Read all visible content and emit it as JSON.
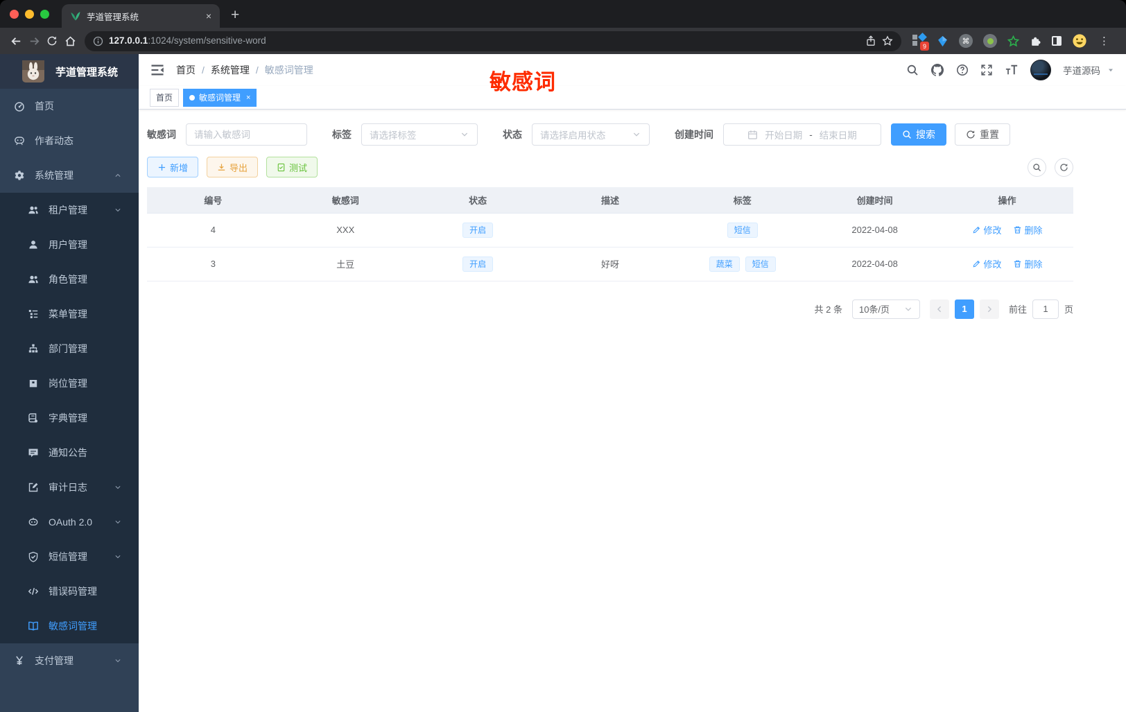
{
  "browser": {
    "tab_title": "芋道管理系统",
    "new_tab": "+",
    "close_tab": "×",
    "url_host": "127.0.0.1",
    "url_path": ":1024/system/sensitive-word",
    "extension_badge": "9",
    "command_glyph": "⌘",
    "menu_dots": "⋮"
  },
  "annotation": {
    "text": "敏感词",
    "color": "#fe2c00"
  },
  "sidebar": {
    "logo_title": "芋道管理系统",
    "items_top": [
      {
        "label": "首页",
        "icon": "dashboard-icon"
      },
      {
        "label": "作者动态",
        "icon": "chat-icon"
      },
      {
        "label": "系统管理",
        "icon": "gear-icon",
        "arrow": "up"
      }
    ],
    "items_sub": [
      {
        "label": "租户管理",
        "icon": "users-icon",
        "arrow": "down"
      },
      {
        "label": "用户管理",
        "icon": "user-icon"
      },
      {
        "label": "角色管理",
        "icon": "users-icon"
      },
      {
        "label": "菜单管理",
        "icon": "menu-tree-icon"
      },
      {
        "label": "部门管理",
        "icon": "org-icon"
      },
      {
        "label": "岗位管理",
        "icon": "badge-icon"
      },
      {
        "label": "字典管理",
        "icon": "dict-icon"
      },
      {
        "label": "通知公告",
        "icon": "notice-icon"
      },
      {
        "label": "审计日志",
        "icon": "log-icon",
        "arrow": "down"
      },
      {
        "label": "OAuth 2.0",
        "icon": "robot-icon",
        "arrow": "down"
      },
      {
        "label": "短信管理",
        "icon": "shield-icon",
        "arrow": "down"
      },
      {
        "label": "错误码管理",
        "icon": "code-icon"
      },
      {
        "label": "敏感词管理",
        "icon": "book-icon",
        "active": true
      }
    ],
    "items_bottom": [
      {
        "label": "支付管理",
        "icon": "yen-icon",
        "arrow": "down"
      }
    ]
  },
  "header": {
    "breadcrumb": [
      "首页",
      "系统管理",
      "敏感词管理"
    ],
    "username": "芋道源码"
  },
  "tags_view": [
    {
      "label": "首页"
    },
    {
      "label": "敏感词管理",
      "close": "×",
      "active": true
    }
  ],
  "filters": {
    "keyword_label": "敏感词",
    "keyword_placeholder": "请输入敏感词",
    "tag_label": "标签",
    "tag_placeholder": "请选择标签",
    "status_label": "状态",
    "status_placeholder": "请选择启用状态",
    "date_label": "创建时间",
    "date_start_placeholder": "开始日期",
    "date_separator": "-",
    "date_end_placeholder": "结束日期",
    "search_label": "搜索",
    "reset_label": "重置"
  },
  "toolbar": {
    "add_label": "新增",
    "export_label": "导出",
    "test_label": "测试"
  },
  "table": {
    "columns": [
      "编号",
      "敏感词",
      "状态",
      "描述",
      "标签",
      "创建时间",
      "操作"
    ],
    "edit_label": "修改",
    "delete_label": "删除",
    "rows": [
      {
        "id": "4",
        "word": "XXX",
        "status": "开启",
        "description": "",
        "tags": [
          "短信"
        ],
        "created": "2022-04-08"
      },
      {
        "id": "3",
        "word": "土豆",
        "status": "开启",
        "description": "好呀",
        "tags": [
          "蔬菜",
          "短信"
        ],
        "created": "2022-04-08"
      }
    ]
  },
  "pagination": {
    "total_text": "共 2 条",
    "page_size": "10条/页",
    "current_page": "1",
    "goto_label": "前往",
    "goto_value": "1",
    "page_unit": "页"
  },
  "colors": {
    "primary": "#409eff",
    "sidebar_bg": "#304156",
    "submenu_bg": "#1f2d3d",
    "tag_bg": "#ecf5ff",
    "annotation_red": "#fe2c00"
  }
}
